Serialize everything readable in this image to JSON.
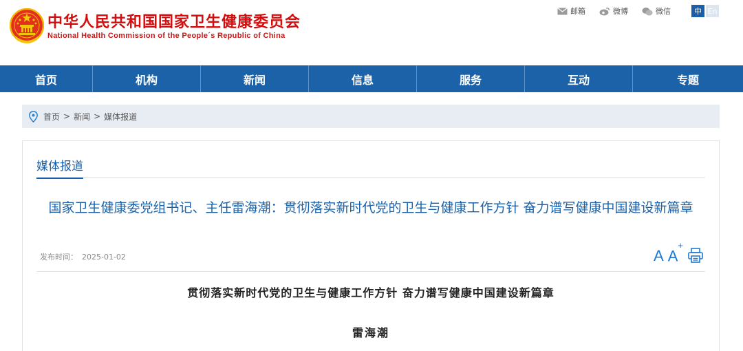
{
  "header": {
    "title": "中华人民共和国国家卫生健康委员会",
    "subtitle": "National Health Commission of the People´s Republic of China",
    "links": [
      {
        "label": "邮箱",
        "icon": "mail-icon"
      },
      {
        "label": "微博",
        "icon": "weibo-icon"
      },
      {
        "label": "微信",
        "icon": "wechat-icon"
      }
    ],
    "lang": {
      "zh": "中",
      "en": "En"
    }
  },
  "nav": {
    "items": [
      "首页",
      "机构",
      "新闻",
      "信息",
      "服务",
      "互动",
      "专题"
    ]
  },
  "breadcrumb": {
    "items": [
      "首页",
      "新闻",
      "媒体报道"
    ],
    "separator": ">"
  },
  "section": {
    "title": "媒体报道"
  },
  "article": {
    "title": "国家卫生健康委党组书记、主任雷海潮：贯彻落实新时代党的卫生与健康工作方针 奋力谱写健康中国建设新篇章",
    "meta_label": "发布时间：",
    "date": "2025-01-02",
    "tools": {
      "font_small": "A",
      "font_large": "A",
      "font_large_sup": "+"
    },
    "body_subtitle": "贯彻落实新时代党的卫生与健康工作方针 奋力谱写健康中国建设新篇章",
    "author": "雷海潮"
  },
  "colors": {
    "brand_red": "#d40e0e",
    "nav_blue": "#1b62a9",
    "title_blue": "#1b62a9",
    "breadcrumb_bg": "#e8edf3"
  }
}
